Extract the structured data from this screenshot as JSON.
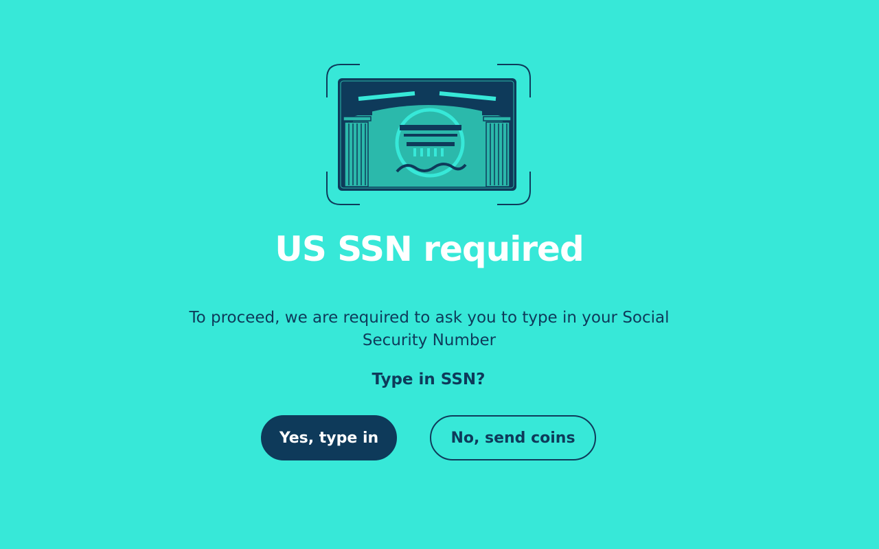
{
  "illustration": {
    "icon": "ssn-card-icon",
    "colors": {
      "navy": "#0e3a5a",
      "teal": "#2bb9ab",
      "accent": "#37e8d8"
    }
  },
  "title": "US SSN required",
  "description": "To proceed, we are required to ask you to type in your Social Security Number",
  "question": "Type in SSN?",
  "buttons": {
    "yes_label": "Yes, type in",
    "no_label": "No, send coins"
  },
  "colors": {
    "background": "#37e8d8",
    "primary": "#0e3a5a",
    "title_text": "#ffffff"
  }
}
